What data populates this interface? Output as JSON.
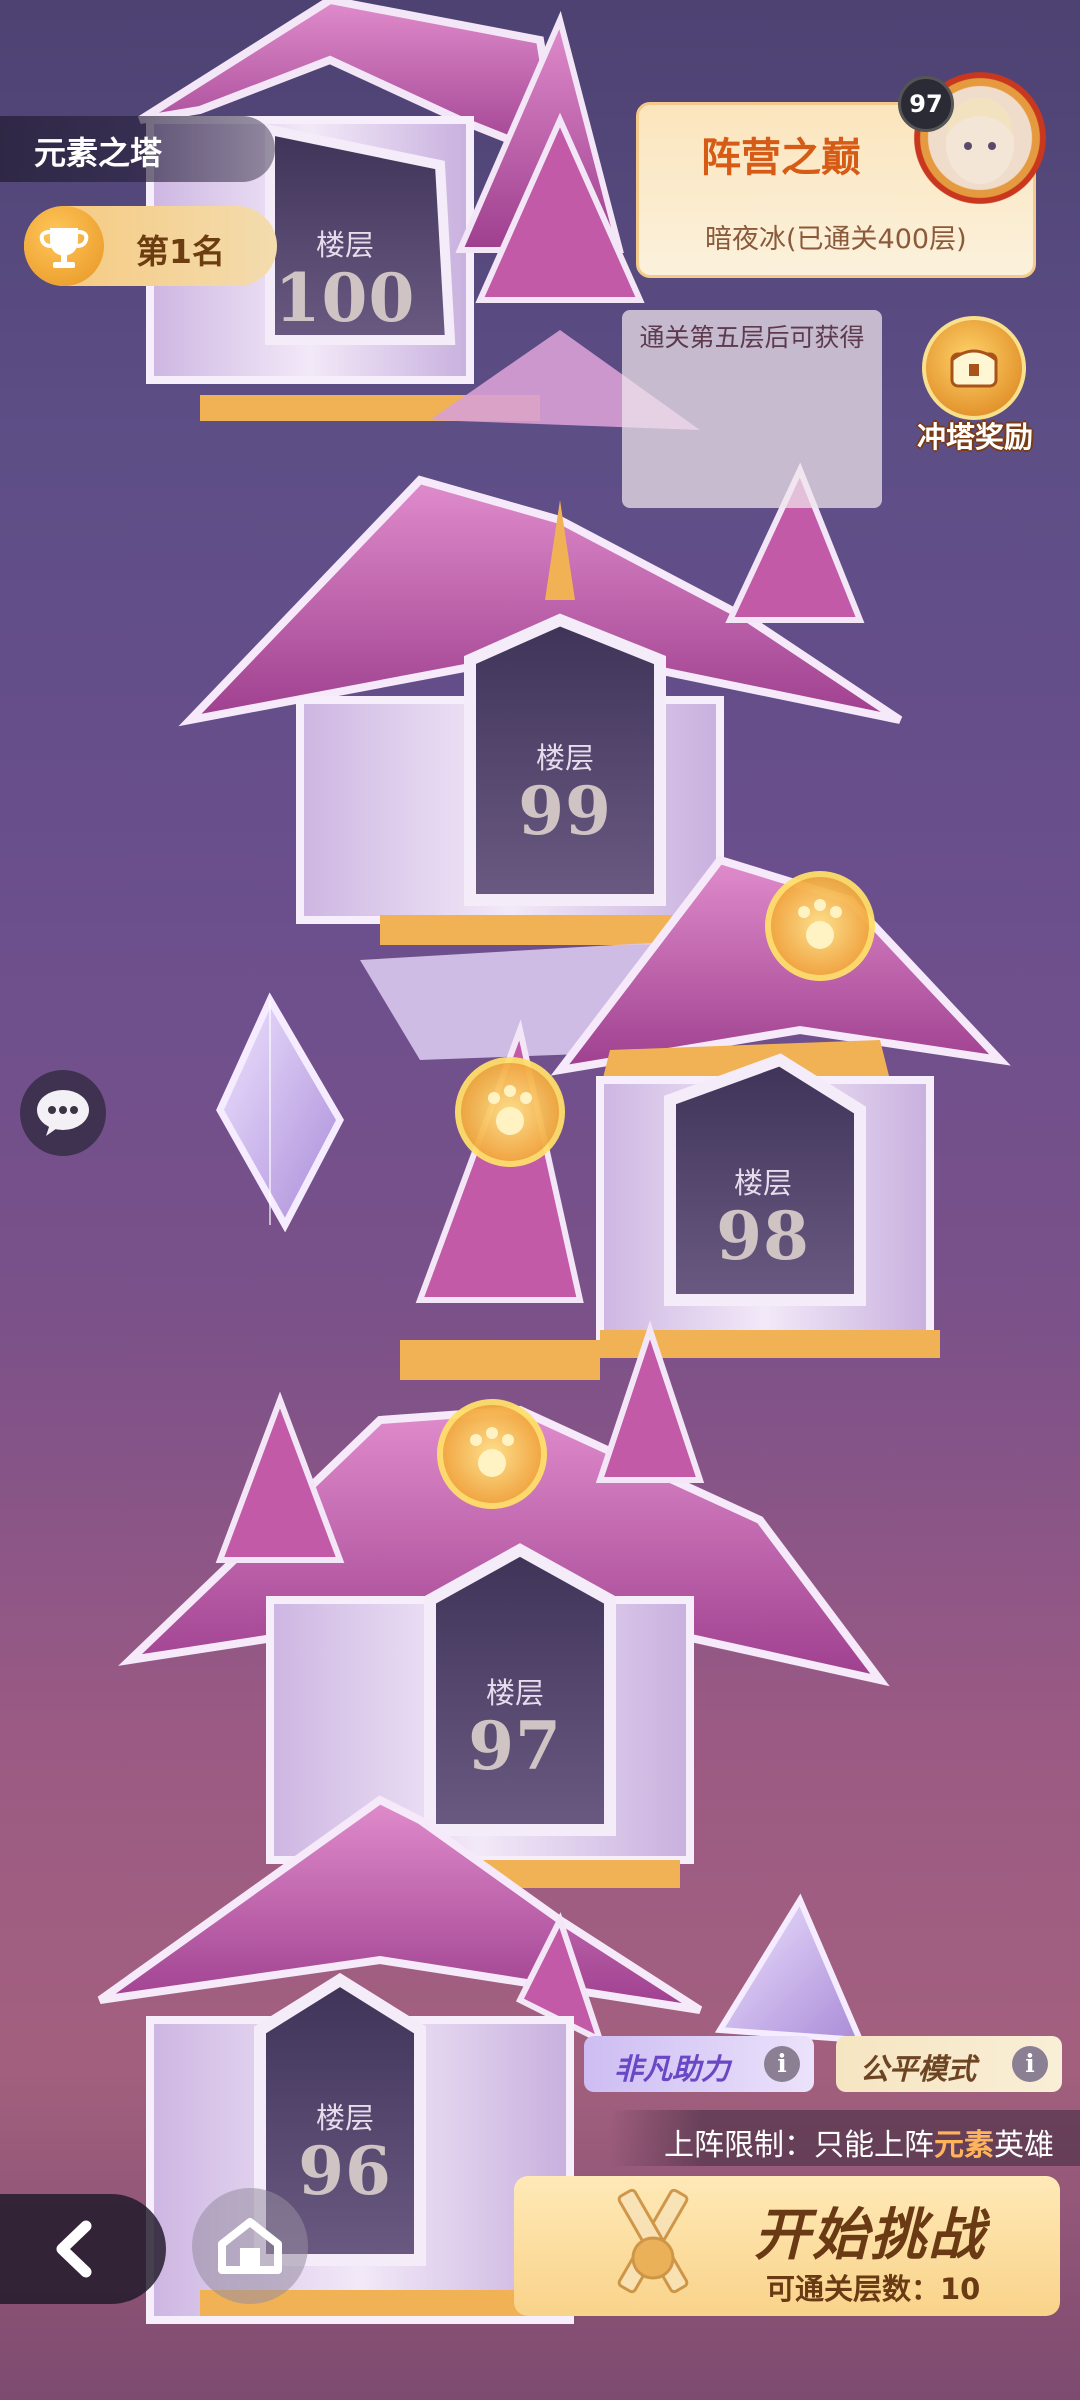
{
  "header": {
    "tower_name": "元素之塔",
    "rank": "第1名"
  },
  "camp_panel": {
    "title": "阵营之巅",
    "subtitle": "暗夜冰(已通关400层)",
    "level": "97"
  },
  "reward": {
    "hint": "通关第五层后可获得",
    "label": "冲塔奖励"
  },
  "floors": [
    {
      "label": "楼层",
      "number": "100"
    },
    {
      "label": "楼层",
      "number": "99"
    },
    {
      "label": "楼层",
      "number": "98"
    },
    {
      "label": "楼层",
      "number": "97"
    },
    {
      "label": "楼层",
      "number": "96"
    }
  ],
  "bottom": {
    "tag_assist": "非凡助力",
    "tag_fair": "公平模式",
    "info_glyph": "i",
    "restriction_prefix": "上阵限制：只能上阵",
    "restriction_highlight": "元素",
    "restriction_suffix": "英雄",
    "start_label": "开始挑战",
    "clear_count_label": "可通关层数：10"
  },
  "colors": {
    "roof": "#c25aa8",
    "roof_light": "#e89ad3",
    "wall": "#e8dcf1",
    "door": "#4b3d63",
    "gold": "#f1b256",
    "accent_orange": "#d65b16"
  }
}
